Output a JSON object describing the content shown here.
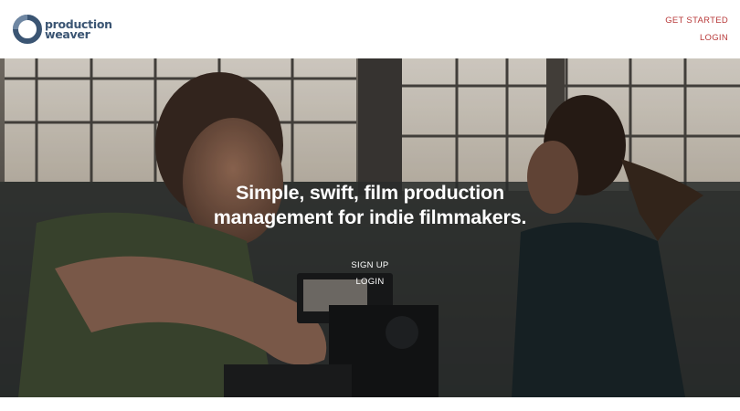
{
  "brand": {
    "line1": "production",
    "line2": "weaver",
    "color": "#3b5573"
  },
  "nav": {
    "get_started": "GET STARTED",
    "login": "LOGIN",
    "color": "#b83a3a"
  },
  "hero": {
    "headline": "Simple, swift, film production management for indie filmmakers.",
    "signup": "SIGN UP",
    "login": "LOGIN"
  }
}
